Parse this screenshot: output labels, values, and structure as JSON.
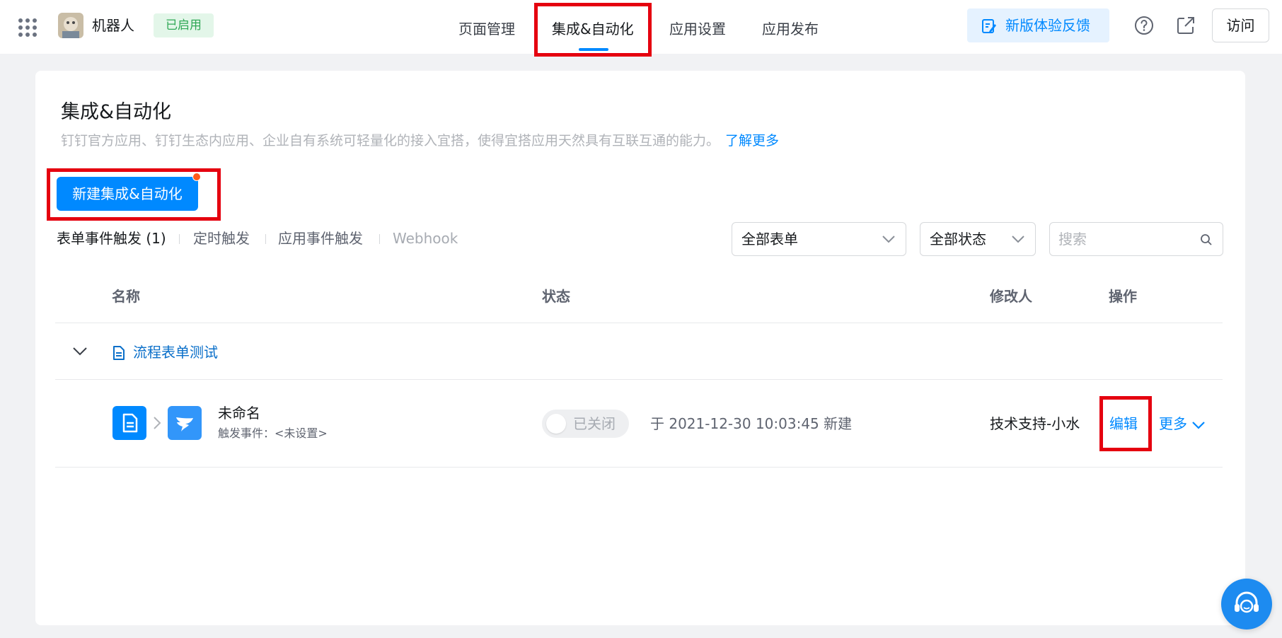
{
  "header": {
    "app_name": "机器人",
    "status_badge": "已启用",
    "tabs": [
      {
        "label": "页面管理"
      },
      {
        "label": "集成&自动化"
      },
      {
        "label": "应用设置"
      },
      {
        "label": "应用发布"
      }
    ],
    "active_tab": "集成&自动化",
    "feedback_label": "新版体验反馈",
    "visit_label": "访问"
  },
  "page": {
    "title": "集成&自动化",
    "description": "钉钉官方应用、钉钉生态内应用、企业自有系统可轻量化的接入宜搭，使得宜搭应用天然具有互联互通的能力。",
    "learn_more": "了解更多",
    "new_button": "新建集成&自动化"
  },
  "subtabs": [
    {
      "label": "表单事件触发 (1)"
    },
    {
      "label": "定时触发"
    },
    {
      "label": "应用事件触发"
    },
    {
      "label": "Webhook"
    }
  ],
  "filters": {
    "form_select": "全部表单",
    "status_select": "全部状态",
    "search_placeholder": "搜索"
  },
  "table": {
    "columns": [
      "名称",
      "状态",
      "修改人",
      "操作"
    ],
    "groups": [
      {
        "name": "流程表单测试",
        "rows": [
          {
            "name": "未命名",
            "trigger": "触发事件：<未设置>",
            "status": "已关闭",
            "enabled": false,
            "created": "于 2021-12-30 10:03:45 新建",
            "modifier": "技术支持-小水",
            "edit_label": "编辑",
            "more_label": "更多"
          }
        ]
      }
    ]
  },
  "colors": {
    "accent": "#0089ff",
    "highlight": "#e5000f",
    "badge_green": "#2fa855"
  },
  "icons": {
    "apps": "grid-icon",
    "feedback": "edit-note-icon",
    "help": "question-circle-icon",
    "open": "external-link-icon",
    "support": "headset-icon"
  }
}
